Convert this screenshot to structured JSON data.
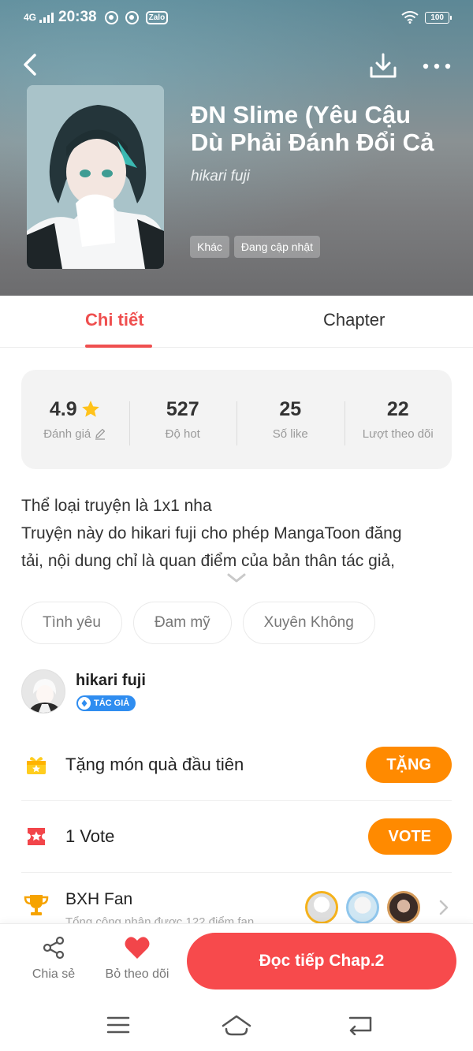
{
  "status_bar": {
    "network": "4G",
    "time": "20:38",
    "zalo_label": "Zalo",
    "battery": "100"
  },
  "book": {
    "title": "ĐN Slime (Yêu Cậu Dù Phải Đánh Đổi Cả",
    "author": "hikari fuji",
    "tags": [
      "Khác",
      "Đang cập nhật"
    ]
  },
  "tabs": [
    {
      "label": "Chi tiết",
      "active": true
    },
    {
      "label": "Chapter",
      "active": false
    }
  ],
  "stats": {
    "rating": {
      "value": "4.9",
      "label": "Đánh giá"
    },
    "hot": {
      "value": "527",
      "label": "Độ hot"
    },
    "likes": {
      "value": "25",
      "label": "Số like"
    },
    "followers": {
      "value": "22",
      "label": "Lượt theo dõi"
    }
  },
  "description": {
    "lines": [
      "Thể loại truyện là 1x1 nha",
      "Truyện này do hikari fuji cho phép MangaToon đăng",
      "tải, nội dung chỉ là quan điểm của bản thân tác giả,"
    ]
  },
  "genres": [
    "Tình yêu",
    "Đam mỹ",
    "Xuyên Không"
  ],
  "author_section": {
    "name": "hikari fuji",
    "badge": "TÁC GIẢ"
  },
  "gift": {
    "label": "Tặng món quà đầu tiên",
    "button": "TẶNG"
  },
  "vote": {
    "label": "1 Vote",
    "button": "VOTE"
  },
  "fan_ranking": {
    "title": "BXH Fan",
    "subtitle": "Tổng cộng nhận được 122 điểm fan"
  },
  "bottom_bar": {
    "share": "Chia sẻ",
    "unfollow": "Bỏ theo dõi",
    "read_button": "Đọc tiếp Chap.2"
  },
  "colors": {
    "accent_red": "#ef4f4f",
    "orange": "#ff8a00",
    "read_button": "#f74a4c"
  }
}
